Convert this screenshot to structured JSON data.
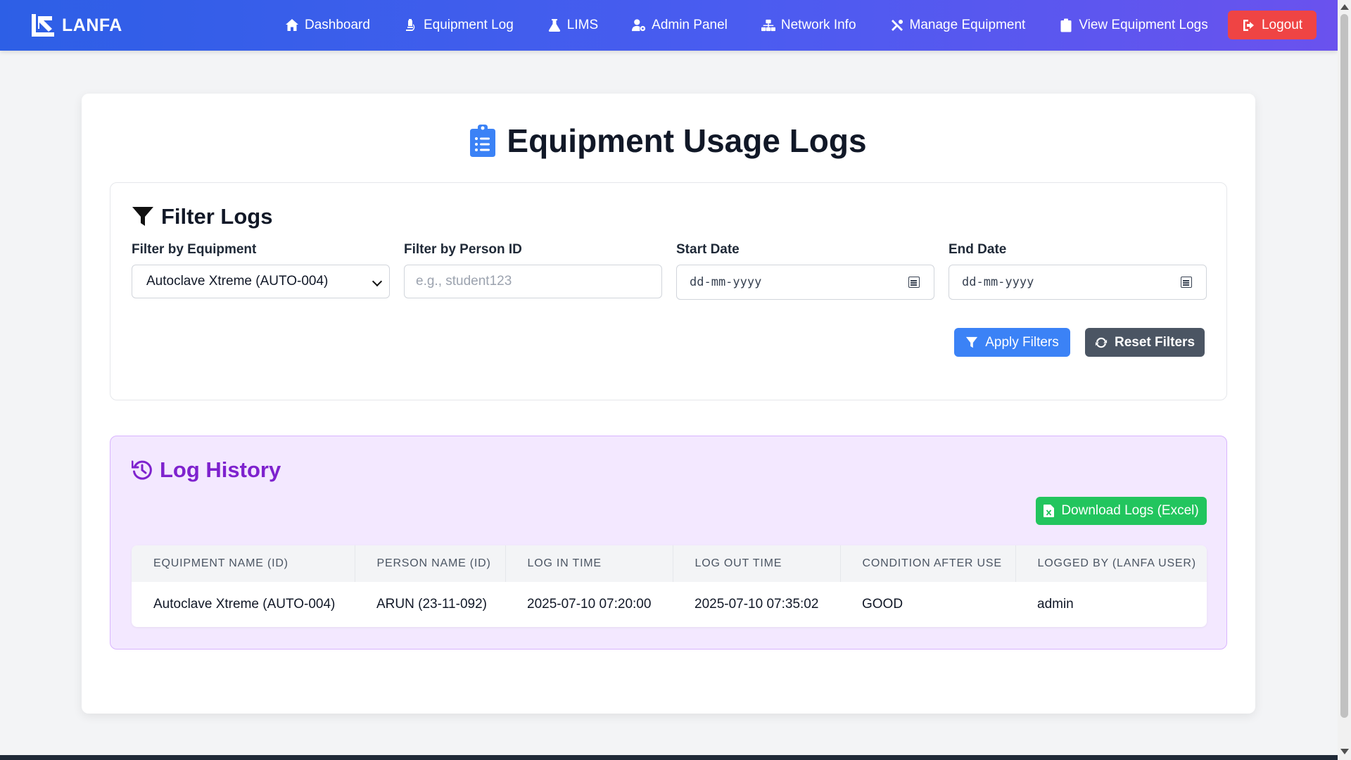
{
  "brand": {
    "name": "LANFA"
  },
  "nav": {
    "items": [
      {
        "label": "Dashboard",
        "icon": "home-icon"
      },
      {
        "label": "Equipment Log",
        "icon": "microscope-icon"
      },
      {
        "label": "LIMS",
        "icon": "flask-icon"
      },
      {
        "label": "Admin Panel",
        "icon": "user-gear-icon"
      },
      {
        "label": "Network Info",
        "icon": "network-icon"
      },
      {
        "label": "Manage Equipment",
        "icon": "tools-icon"
      },
      {
        "label": "View Equipment Logs",
        "icon": "clipboard-icon"
      }
    ],
    "logout_label": "Logout"
  },
  "page": {
    "title": "Equipment Usage Logs"
  },
  "filters": {
    "title": "Filter Logs",
    "equipment_label": "Filter by Equipment",
    "equipment_value": "Autoclave Xtreme (AUTO-004)",
    "person_label": "Filter by Person ID",
    "person_placeholder": "e.g., student123",
    "start_label": "Start Date",
    "start_value": "dd-mm-yyyy",
    "end_label": "End Date",
    "end_value": "dd-mm-yyyy",
    "apply_label": "Apply Filters",
    "reset_label": "Reset Filters"
  },
  "log_history": {
    "title": "Log History",
    "download_label": "Download Logs (Excel)",
    "columns": [
      "EQUIPMENT NAME (ID)",
      "PERSON NAME (ID)",
      "LOG IN TIME",
      "LOG OUT TIME",
      "CONDITION AFTER USE",
      "LOGGED BY (LANFA USER)"
    ],
    "rows": [
      [
        "Autoclave Xtreme (AUTO-004)",
        "ARUN (23-11-092)",
        "2025-07-10 07:20:00",
        "2025-07-10 07:35:02",
        "GOOD",
        "admin"
      ]
    ]
  },
  "colors": {
    "nav_gradient_start": "#2d5fe6",
    "nav_gradient_end": "#6a52ee",
    "logout": "#ef4444",
    "apply": "#3b82f6",
    "reset": "#4b5563",
    "download": "#22c55e",
    "log_accent": "#7e22ce",
    "log_bg": "#f3e8ff"
  }
}
